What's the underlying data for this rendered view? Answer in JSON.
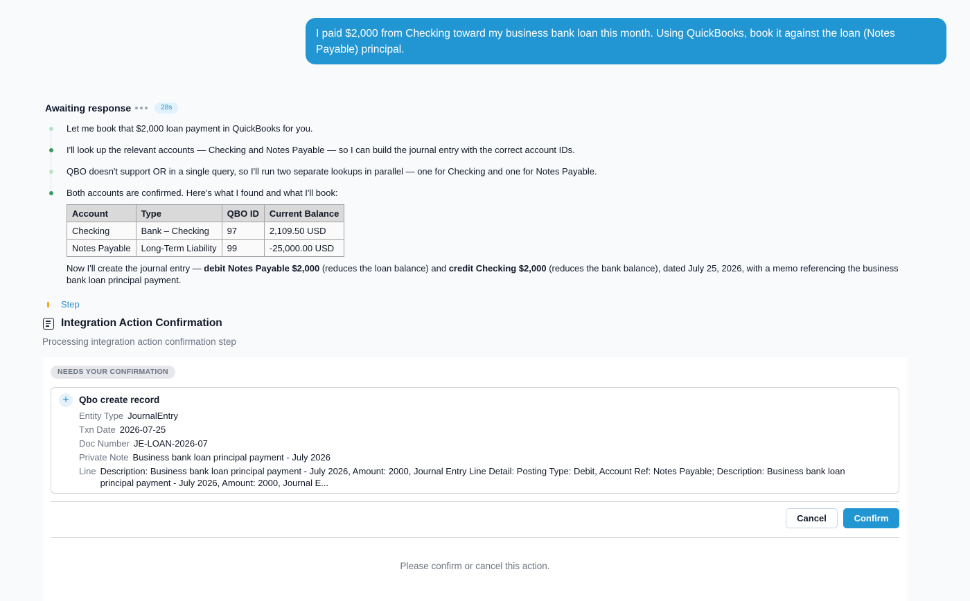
{
  "user_message": "I paid $2,000 from Checking toward my business bank loan this month. Using QuickBooks, book it against the loan (Notes Payable) principal.",
  "status": {
    "title": "Awaiting response",
    "timer": "28s"
  },
  "timeline": [
    "Let me book that $2,000 loan payment in QuickBooks for you.",
    "I'll look up the relevant accounts — Checking and Notes Payable — so I can build the journal entry with the correct account IDs.",
    "QBO doesn't support OR in a single query, so I'll run two separate lookups in parallel — one for Checking and one for Notes Payable.",
    "Both accounts are confirmed. Here's what I found and what I'll book:"
  ],
  "accounts_table": {
    "headers": [
      "Account",
      "Type",
      "QBO ID",
      "Current Balance"
    ],
    "rows": [
      [
        "Checking",
        "Bank – Checking",
        "97",
        "2,109.50 USD"
      ],
      [
        "Notes Payable",
        "Long-Term Liability",
        "99",
        "-25,000.00 USD"
      ]
    ]
  },
  "journal_plan": {
    "t1": "Now I'll create the journal entry — ",
    "b1": "debit Notes Payable $2,000",
    "t2": " (reduces the loan balance) and ",
    "b2": "credit Checking $2,000",
    "t3": " (reduces the bank balance), dated July 25, 2026, with a memo referencing the business bank loan principal payment."
  },
  "step": {
    "label": "Step",
    "title": "Integration Action Confirmation",
    "subtitle": "Processing integration action confirmation step"
  },
  "confirmation": {
    "badge": "NEEDS YOUR CONFIRMATION",
    "record_title": "Qbo create record",
    "fields": [
      {
        "key": "Entity Type",
        "value": "JournalEntry"
      },
      {
        "key": "Txn Date",
        "value": "2026-07-25"
      },
      {
        "key": "Doc Number",
        "value": "JE-LOAN-2026-07"
      },
      {
        "key": "Private Note",
        "value": "Business bank loan principal payment - July 2026"
      },
      {
        "key": "Line",
        "value": "Description: Business bank loan principal payment - July 2026, Amount: 2000, Journal Entry Line Detail: Posting Type: Debit, Account Ref: Notes Payable; Description: Business bank loan principal payment - July 2026, Amount: 2000, Journal E..."
      }
    ],
    "cancel_label": "Cancel",
    "confirm_label": "Confirm",
    "footer": "Please confirm or cancel this action."
  },
  "colors": {
    "accent": "#2196d3",
    "step_marker": "#f5a623",
    "timeline_dot_done": "#3a9a5b",
    "timeline_dot_light": "#b7e4c7"
  }
}
